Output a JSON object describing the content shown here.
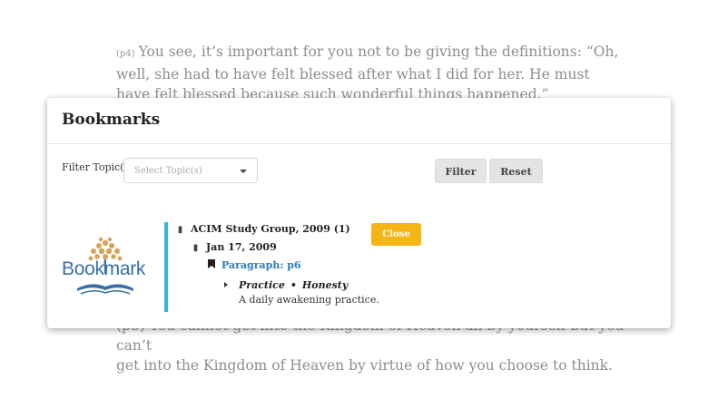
{
  "background": {
    "top": {
      "paragraph_number": "(p4)",
      "text": "You see, it’s important for you not to be giving the definitions: “Oh, well, she had to have felt blessed after what I did for her. He must have felt blessed because such wonderful things happened.”"
    },
    "bottom": {
      "line1": "(p5) You cannot get into the Kingdom of Heaven all by yourself but you can’t",
      "line2": "get into the Kingdom of Heaven by virtue of how you choose to think."
    }
  },
  "modal": {
    "title": "Bookmarks",
    "filter": {
      "label": "Filter Topic(s)",
      "placeholder": "Select Topic(s)",
      "filter_button": "Filter",
      "reset_button": "Reset"
    },
    "logo": {
      "text": "Bookmark",
      "icon": "tree-book-logo",
      "colors": {
        "tree": "#d6a35a",
        "text": "#3a6fa8"
      }
    },
    "bookmark": {
      "group": "ACIM Study Group, 2009 (1)",
      "date": "Jan 17, 2009",
      "paragraph": "Paragraph: p6",
      "topics": [
        "Practice",
        "Honesty"
      ],
      "topic_separator": "•",
      "description": "A daily awakening practice.",
      "close_button": "Close",
      "icons": {
        "group": "book-icon",
        "date": "document-icon",
        "paragraph": "bookmark-icon",
        "expand": "caret-right-icon"
      }
    },
    "colors": {
      "accent_bar": "#36b8dd",
      "close_button": "#f4b515",
      "link": "#2d7ab8"
    }
  }
}
